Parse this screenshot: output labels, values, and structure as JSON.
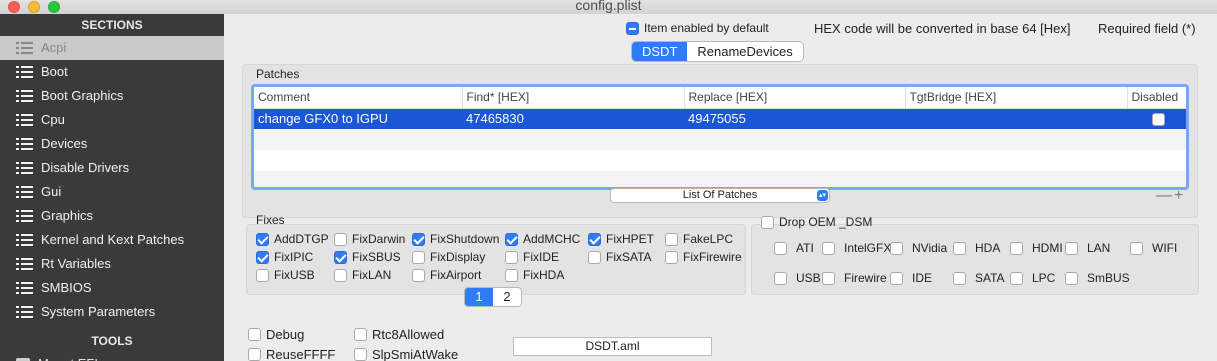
{
  "window": {
    "title": "config.plist"
  },
  "sidebar": {
    "sections_header": "SECTIONS",
    "items": [
      {
        "label": "Acpi",
        "selected": true
      },
      {
        "label": "Boot"
      },
      {
        "label": "Boot Graphics"
      },
      {
        "label": "Cpu"
      },
      {
        "label": "Devices"
      },
      {
        "label": "Disable Drivers"
      },
      {
        "label": "Gui"
      },
      {
        "label": "Graphics"
      },
      {
        "label": "Kernel and Kext Patches"
      },
      {
        "label": "Rt Variables"
      },
      {
        "label": "SMBIOS"
      },
      {
        "label": "System Parameters"
      }
    ],
    "tools_header": "TOOLS",
    "tools_items": [
      {
        "label": "Mount EFI"
      }
    ]
  },
  "header": {
    "item_enabled_label": "Item enabled by default",
    "hex_note": "HEX code will be converted in base 64 [Hex]",
    "required_note": "Required field (*)"
  },
  "tabs": [
    {
      "label": "DSDT",
      "active": true
    },
    {
      "label": "RenameDevices",
      "active": false
    }
  ],
  "patches": {
    "title": "Patches",
    "columns": [
      "Comment",
      "Find* [HEX]",
      "Replace [HEX]",
      "TgtBridge [HEX]",
      "Disabled"
    ],
    "rows": [
      {
        "comment": "change GFX0 to IGPU",
        "find": "47465830",
        "replace": "49475055",
        "tgtbridge": "",
        "disabled": false
      }
    ],
    "list_popup": "List Of Patches",
    "plus_minus": "—+"
  },
  "fixes": {
    "title": "Fixes",
    "items": [
      {
        "label": "AddDTGP",
        "checked": true
      },
      {
        "label": "FixDarwin",
        "checked": false
      },
      {
        "label": "FixShutdown",
        "checked": true
      },
      {
        "label": "AddMCHC",
        "checked": true
      },
      {
        "label": "FixHPET",
        "checked": true
      },
      {
        "label": "FakeLPC",
        "checked": false
      },
      {
        "label": "FixIPIC",
        "checked": true
      },
      {
        "label": "FixSBUS",
        "checked": true
      },
      {
        "label": "FixDisplay",
        "checked": false
      },
      {
        "label": "FixIDE",
        "checked": false
      },
      {
        "label": "FixSATA",
        "checked": false
      },
      {
        "label": "FixFirewire",
        "checked": false
      },
      {
        "label": "FixUSB",
        "checked": false
      },
      {
        "label": "FixLAN",
        "checked": false
      },
      {
        "label": "FixAirport",
        "checked": false
      },
      {
        "label": "FixHDA",
        "checked": false
      }
    ],
    "pages": [
      "1",
      "2"
    ],
    "active_page": "1"
  },
  "drop_oem": {
    "label": "Drop OEM _DSM",
    "items": [
      {
        "label": "ATI"
      },
      {
        "label": "IntelGFX"
      },
      {
        "label": "NVidia"
      },
      {
        "label": "HDA"
      },
      {
        "label": "HDMI"
      },
      {
        "label": "LAN"
      },
      {
        "label": "WIFI"
      },
      {
        "label": "USB"
      },
      {
        "label": "Firewire"
      },
      {
        "label": "IDE"
      },
      {
        "label": "SATA"
      },
      {
        "label": "LPC"
      },
      {
        "label": "SmBUS"
      }
    ]
  },
  "bottom": {
    "debug": "Debug",
    "rtc8": "Rtc8Allowed",
    "reuse": "ReuseFFFF",
    "slp": "SlpSmiAtWake",
    "dsdt_name": "DSDT.aml"
  }
}
